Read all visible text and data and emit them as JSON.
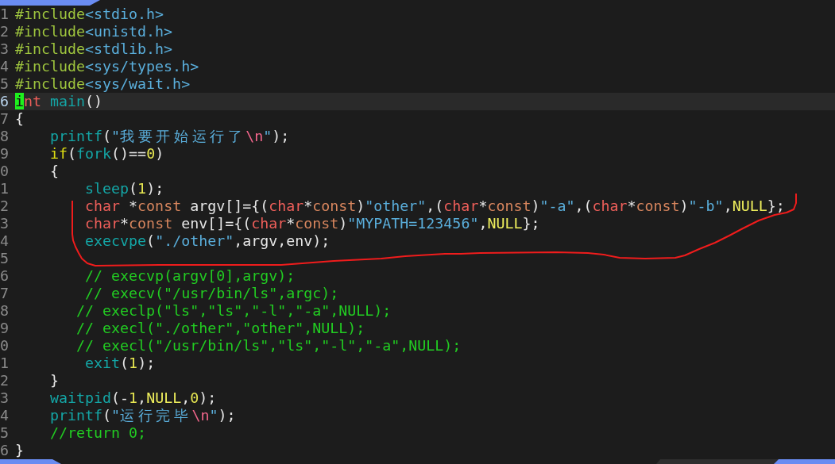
{
  "tabline": {
    "tabs": [
      {
        "selected": true
      }
    ]
  },
  "lines": [
    {
      "number": "1",
      "current": false,
      "tokens": [
        {
          "text": "#include",
          "kind": "preproc"
        },
        {
          "text": "<stdio.h>",
          "kind": "header"
        }
      ]
    },
    {
      "number": "2",
      "current": false,
      "tokens": [
        {
          "text": "#include",
          "kind": "preproc"
        },
        {
          "text": "<unistd.h>",
          "kind": "header"
        }
      ]
    },
    {
      "number": "3",
      "current": false,
      "tokens": [
        {
          "text": "#include",
          "kind": "preproc"
        },
        {
          "text": "<stdlib.h>",
          "kind": "header"
        }
      ]
    },
    {
      "number": "4",
      "current": false,
      "tokens": [
        {
          "text": "#include",
          "kind": "preproc"
        },
        {
          "text": "<sys/types.h>",
          "kind": "header"
        }
      ]
    },
    {
      "number": "5",
      "current": false,
      "tokens": [
        {
          "text": "#include",
          "kind": "preproc"
        },
        {
          "text": "<sys/wait.h>",
          "kind": "header"
        }
      ]
    },
    {
      "number": "6",
      "current": true,
      "tokens": [
        {
          "text": "i",
          "kind": "cursor"
        },
        {
          "text": "nt",
          "kind": "type"
        },
        {
          "text": " main",
          "kind": "function"
        },
        {
          "text": "()",
          "kind": "plain"
        }
      ]
    },
    {
      "number": "7",
      "current": false,
      "tokens": [
        {
          "text": "{",
          "kind": "plain"
        }
      ]
    },
    {
      "number": "8",
      "current": false,
      "tokens": [
        {
          "text": "    printf",
          "kind": "function"
        },
        {
          "text": "(",
          "kind": "plain"
        },
        {
          "text": "\"我要开始运行了",
          "kind": "string"
        },
        {
          "text": "\\n",
          "kind": "escape"
        },
        {
          "text": "\"",
          "kind": "string"
        },
        {
          "text": ");",
          "kind": "plain"
        }
      ]
    },
    {
      "number": "9",
      "current": false,
      "tokens": [
        {
          "text": "    if",
          "kind": "statement"
        },
        {
          "text": "(",
          "kind": "plain"
        },
        {
          "text": "fork",
          "kind": "function"
        },
        {
          "text": "()==",
          "kind": "plain"
        },
        {
          "text": "0",
          "kind": "number"
        },
        {
          "text": ")",
          "kind": "plain"
        }
      ]
    },
    {
      "number": "0",
      "current": false,
      "tokens": [
        {
          "text": "    {",
          "kind": "plain"
        }
      ]
    },
    {
      "number": "1",
      "current": false,
      "tokens": [
        {
          "text": "        sleep",
          "kind": "function"
        },
        {
          "text": "(",
          "kind": "plain"
        },
        {
          "text": "1",
          "kind": "number"
        },
        {
          "text": ");",
          "kind": "plain"
        }
      ]
    },
    {
      "number": "2",
      "current": false,
      "tokens": [
        {
          "text": "        char",
          "kind": "type"
        },
        {
          "text": " *",
          "kind": "plain"
        },
        {
          "text": "const",
          "kind": "qualifier"
        },
        {
          "text": " argv[]={(",
          "kind": "plain"
        },
        {
          "text": "char",
          "kind": "type"
        },
        {
          "text": "*",
          "kind": "plain"
        },
        {
          "text": "const",
          "kind": "qualifier"
        },
        {
          "text": ")",
          "kind": "plain"
        },
        {
          "text": "\"other\"",
          "kind": "string"
        },
        {
          "text": ",(",
          "kind": "plain"
        },
        {
          "text": "char",
          "kind": "type"
        },
        {
          "text": "*",
          "kind": "plain"
        },
        {
          "text": "const",
          "kind": "qualifier"
        },
        {
          "text": ")",
          "kind": "plain"
        },
        {
          "text": "\"-a\"",
          "kind": "string"
        },
        {
          "text": ",(",
          "kind": "plain"
        },
        {
          "text": "char",
          "kind": "type"
        },
        {
          "text": "*",
          "kind": "plain"
        },
        {
          "text": "const",
          "kind": "qualifier"
        },
        {
          "text": ")",
          "kind": "plain"
        },
        {
          "text": "\"-b\"",
          "kind": "string"
        },
        {
          "text": ",",
          "kind": "plain"
        },
        {
          "text": "NULL",
          "kind": "constant"
        },
        {
          "text": "};",
          "kind": "plain"
        }
      ]
    },
    {
      "number": "3",
      "current": false,
      "tokens": [
        {
          "text": "        char",
          "kind": "type"
        },
        {
          "text": "*",
          "kind": "plain"
        },
        {
          "text": "const",
          "kind": "qualifier"
        },
        {
          "text": " env[]={(",
          "kind": "plain"
        },
        {
          "text": "char",
          "kind": "type"
        },
        {
          "text": "*",
          "kind": "plain"
        },
        {
          "text": "const",
          "kind": "qualifier"
        },
        {
          "text": ")",
          "kind": "plain"
        },
        {
          "text": "\"MYPATH=123456\"",
          "kind": "string"
        },
        {
          "text": ",",
          "kind": "plain"
        },
        {
          "text": "NULL",
          "kind": "constant"
        },
        {
          "text": "};",
          "kind": "plain"
        }
      ]
    },
    {
      "number": "4",
      "current": false,
      "tokens": [
        {
          "text": "        execvpe",
          "kind": "function"
        },
        {
          "text": "(",
          "kind": "plain"
        },
        {
          "text": "\"./other\"",
          "kind": "string"
        },
        {
          "text": ",argv,env);",
          "kind": "plain"
        }
      ]
    },
    {
      "number": "5",
      "current": false
    },
    {
      "number": "6",
      "current": false,
      "tokens": [
        {
          "text": "        // execvp(argv[0],argv);",
          "kind": "comment"
        }
      ]
    },
    {
      "number": "7",
      "current": false,
      "tokens": [
        {
          "text": "        // execv(\"/usr/bin/ls\",argc);",
          "kind": "comment"
        }
      ]
    },
    {
      "number": "8",
      "current": false,
      "tokens": [
        {
          "text": "       // execlp(\"ls\",\"ls\",\"-l\",\"-a\",NULL);",
          "kind": "comment"
        }
      ]
    },
    {
      "number": "9",
      "current": false,
      "tokens": [
        {
          "text": "       // execl(\"./other\",\"other\",NULL);",
          "kind": "comment"
        }
      ]
    },
    {
      "number": "0",
      "current": false,
      "tokens": [
        {
          "text": "       // execl(\"/usr/bin/ls\",\"ls\",\"-l\",\"-a\",NULL);",
          "kind": "comment"
        }
      ]
    },
    {
      "number": "1",
      "current": false,
      "tokens": [
        {
          "text": "        exit",
          "kind": "function"
        },
        {
          "text": "(",
          "kind": "plain"
        },
        {
          "text": "1",
          "kind": "number"
        },
        {
          "text": ");",
          "kind": "plain"
        }
      ]
    },
    {
      "number": "2",
      "current": false,
      "tokens": [
        {
          "text": "    }",
          "kind": "plain"
        }
      ]
    },
    {
      "number": "3",
      "current": false,
      "tokens": [
        {
          "text": "    waitpid",
          "kind": "function"
        },
        {
          "text": "(-",
          "kind": "plain"
        },
        {
          "text": "1",
          "kind": "number"
        },
        {
          "text": ",",
          "kind": "plain"
        },
        {
          "text": "NULL",
          "kind": "constant"
        },
        {
          "text": ",",
          "kind": "plain"
        },
        {
          "text": "0",
          "kind": "number"
        },
        {
          "text": ");",
          "kind": "plain"
        }
      ]
    },
    {
      "number": "4",
      "current": false,
      "tokens": [
        {
          "text": "    printf",
          "kind": "function"
        },
        {
          "text": "(",
          "kind": "plain"
        },
        {
          "text": "\"运行完毕",
          "kind": "string"
        },
        {
          "text": "\\n",
          "kind": "escape"
        },
        {
          "text": "\"",
          "kind": "string"
        },
        {
          "text": ");",
          "kind": "plain"
        }
      ]
    },
    {
      "number": "5",
      "current": false,
      "tokens": [
        {
          "text": "    //return 0;",
          "kind": "comment"
        }
      ]
    },
    {
      "number": "6",
      "current": false,
      "tokens": [
        {
          "text": "}",
          "kind": "plain"
        }
      ]
    }
  ],
  "status_bar": {
    "segments": [
      {
        "kind": "mode"
      },
      {
        "kind": "info"
      },
      {
        "kind": "position"
      }
    ]
  },
  "annotations": [
    {
      "kind": "freehand"
    }
  ]
}
